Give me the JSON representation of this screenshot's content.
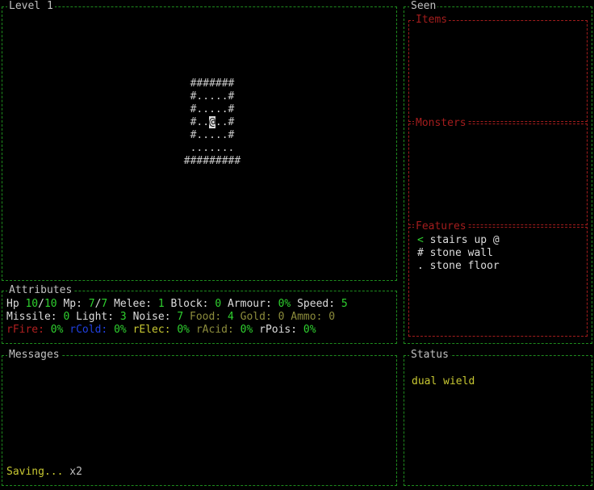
{
  "level_panel": {
    "title": "Level 1"
  },
  "map": {
    "rows": [
      "#######",
      "#.....#",
      "#.....#",
      "#..@..#",
      "#.....#",
      ".......",
      "#########"
    ],
    "player_glyph": "@"
  },
  "seen_panel": {
    "title": "Seen",
    "items_title": "Items",
    "monsters_title": "Monsters",
    "features_title": "Features",
    "features": [
      {
        "glyph": "<",
        "label": "stairs up @"
      },
      {
        "glyph": "#",
        "label": "stone wall"
      },
      {
        "glyph": ".",
        "label": "stone floor"
      }
    ]
  },
  "attributes": {
    "title": "Attributes",
    "hp_label": "Hp",
    "hp_cur": "10",
    "hp_sep": "/",
    "hp_max": "10",
    "mp_label": "Mp:",
    "mp_cur": "7",
    "mp_sep": "/",
    "mp_max": "7",
    "melee_label": "Melee:",
    "melee": "1",
    "block_label": "Block:",
    "block": "0",
    "armour_label": "Armour:",
    "armour": "0%",
    "speed_label": "Speed:",
    "speed": "5",
    "missile_label": "Missile:",
    "missile": "0",
    "light_label": "Light:",
    "light": "3",
    "noise_label": "Noise:",
    "noise": "7",
    "food_label": "Food:",
    "food": "4",
    "gold_label": "Gold:",
    "gold": "0",
    "ammo_label": "Ammo:",
    "ammo": "0",
    "rfire_label": "rFire:",
    "rfire": "0%",
    "rcold_label": "rCold:",
    "rcold": "0%",
    "relec_label": "rElec:",
    "relec": "0%",
    "racid_label": "rAcid:",
    "racid": "0%",
    "rpois_label": "rPois:",
    "rpois": "0%"
  },
  "messages": {
    "title": "Messages",
    "last": "Saving...",
    "count": "x2"
  },
  "status": {
    "title": "Status",
    "effects": [
      "dual wield"
    ]
  },
  "colors": {
    "border": "#1e8c1e",
    "section_border": "#a31d1d",
    "positive": "#2fd12f",
    "warn": "#c8c832"
  }
}
